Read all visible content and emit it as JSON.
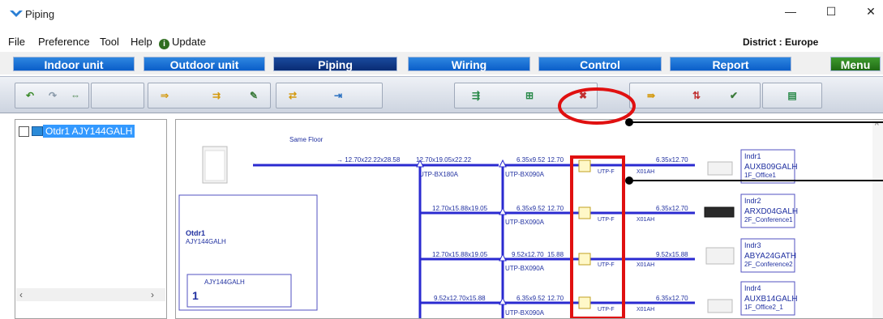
{
  "window": {
    "title": "Piping",
    "minimize": "—",
    "maximize": "☐",
    "close": "✕"
  },
  "menubar": {
    "items": [
      "File",
      "Preference",
      "Tool",
      "Help"
    ],
    "update_label": "Update",
    "district": "District : Europe"
  },
  "tabs": {
    "indoor": "Indoor unit",
    "outdoor": "Outdoor unit",
    "piping": "Piping",
    "wiring": "Wiring",
    "control": "Control",
    "report": "Report",
    "menu": "Menu"
  },
  "sidebar": {
    "tree_item": "Otdr1 AJY144GALH"
  },
  "diagram": {
    "same_floor": "Same Floor",
    "outdoor_box": {
      "name": "Otdr1",
      "model": "AJY144GALH",
      "sub_model": "AJY144GALH",
      "count": "1"
    },
    "main_pipe": "12.70x22.22x28.58",
    "pipe_a": "12.70x19.05x22.22",
    "branch_main": "UTP-BX180A",
    "rows": [
      {
        "pipe_left": "6.35x9.52",
        "pipe_left_val": "12.70",
        "branch": "UTP-BX090A",
        "pipe_right": "6.35x12.70",
        "joint": "UTP-FX01AH",
        "joint_vis": "UTP-F",
        "joint_tail": "X01AH",
        "unit": "Indr1",
        "model": "AUXB09GALH",
        "room": "1F_Office1"
      },
      {
        "pipe_mid": "12.70x15.88x19.05",
        "pipe_left": "6.35x9.52",
        "pipe_left_val": "12.70",
        "branch": "UTP-BX090A",
        "pipe_right": "6.35x12.70",
        "joint": "UTP-FX01AH",
        "joint_vis": "UTP-F",
        "joint_tail": "X01AH",
        "unit": "Indr2",
        "model": "ARXD04GALH",
        "room": "2F_Conference1"
      },
      {
        "pipe_mid": "12.70x15.88x19.05",
        "pipe_left": "9.52x12.70",
        "pipe_left_val": "15.88",
        "branch": "UTP-BX090A",
        "pipe_right": "9.52x15.88",
        "joint": "UTP-FX01AH",
        "joint_vis": "UTP-F",
        "joint_tail": "X01AH",
        "unit": "Indr3",
        "model": "ABYA24GATH",
        "room": "2F_Conference2"
      },
      {
        "pipe_mid": "9.52x12.70x15.88",
        "pipe_left": "6.35x9.52",
        "pipe_left_val": "12.70",
        "branch": "UTP-BX090A",
        "pipe_right": "6.35x12.70",
        "joint": "UTP-FX01AH",
        "joint_vis": "UTP-F",
        "joint_tail": "X01AH",
        "unit": "Indr4",
        "model": "AUXB14GALH",
        "room": "1F_Office2_1"
      }
    ]
  },
  "colors": {
    "pipe": "#2a2ad0",
    "highlight": "#e01010",
    "tab": "#0b5ec9",
    "tab_active": "#0a2c74",
    "menu_tab": "#2f8a22",
    "tree_select": "#3399ff"
  }
}
